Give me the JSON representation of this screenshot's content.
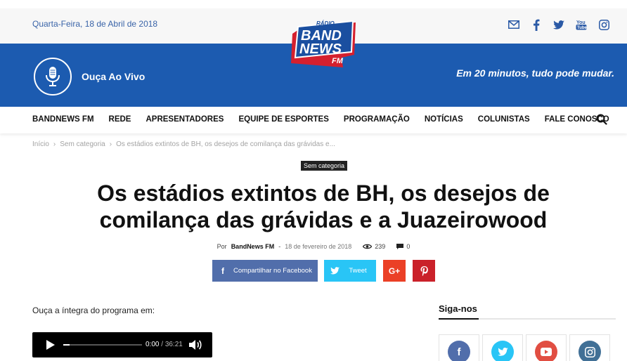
{
  "topbar": {
    "date": "Quarta-Feira, 18 de Abril de 2018",
    "social_icons": [
      "mail-icon",
      "facebook-icon",
      "twitter-icon",
      "youtube-icon",
      "instagram-icon"
    ]
  },
  "logo": {
    "radio": "RÁDIO",
    "band": "BAND",
    "news": "NEWS",
    "fm": "FM"
  },
  "header": {
    "live_label": "Ouça Ao Vivo",
    "slogan": "Em 20 minutos, tudo pode mudar."
  },
  "nav": {
    "items": [
      "BANDNEWS FM",
      "REDE",
      "APRESENTADORES",
      "EQUIPE DE ESPORTES",
      "PROGRAMAÇÃO",
      "NOTÍCIAS",
      "COLUNISTAS",
      "FALE CONOSCO"
    ]
  },
  "breadcrumb": {
    "items": [
      "Início",
      "Sem categoria",
      "Os estádios extintos de BH, os desejos de comilança das grávidas e..."
    ]
  },
  "article": {
    "category": "Sem categoria",
    "title": "Os estádios extintos de BH, os desejos de comilança das grávidas e a Juazeirowood",
    "by": "Por",
    "author": "BandNews FM",
    "dash": "-",
    "date": "18 de fevereiro de 2018",
    "views": "239",
    "comments": "0",
    "intro": "Ouça a íntegra do programa em:"
  },
  "share": {
    "facebook": "Compartilhar no Facebook",
    "twitter": "Tweet",
    "googleplus": "G+",
    "pinterest": "P"
  },
  "player": {
    "current": "0:00",
    "sep": "/",
    "total": "36:21",
    "progress_fraction": 0.08
  },
  "sidebar": {
    "title": "Siga-nos",
    "networks": [
      {
        "icon": "facebook-icon",
        "color": "#516eab",
        "glyph": "f"
      },
      {
        "icon": "twitter-icon",
        "color": "#29c5f6",
        "glyph": ""
      },
      {
        "icon": "youtube-icon",
        "color": "#e14e42",
        "glyph": ""
      },
      {
        "icon": "instagram-icon",
        "color": "#417096",
        "glyph": ""
      }
    ]
  },
  "colors": {
    "brand_blue": "#1c5bb0",
    "logo_red": "#d5202e",
    "facebook": "#516eab",
    "twitter": "#29c5f6",
    "googleplus": "#eb4026",
    "pinterest": "#ca212a"
  }
}
